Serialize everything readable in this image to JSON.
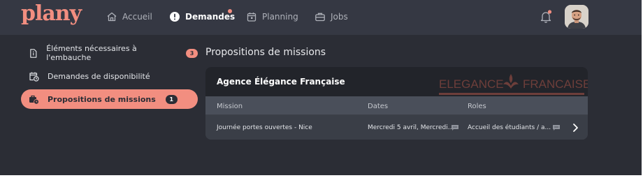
{
  "app": {
    "logo": "plany"
  },
  "nav": {
    "items": [
      {
        "label": "Accueil",
        "icon": "home-icon"
      },
      {
        "label": "Demandes",
        "icon": "alert-circle-icon"
      },
      {
        "label": "Planning",
        "icon": "calendar-icon"
      },
      {
        "label": "Jobs",
        "icon": "briefcase-icon"
      }
    ]
  },
  "sidebar": {
    "items": [
      {
        "label": "Éléments nécessaires à l'embauche",
        "badge": "3",
        "icon": "document-icon"
      },
      {
        "label": "Demandes de disponibilité",
        "icon": "calendar-clock-icon"
      },
      {
        "label": "Propositions de missions",
        "badge": "1",
        "icon": "briefcase-clock-icon"
      }
    ]
  },
  "main": {
    "title": "Propositions de missions",
    "agency": {
      "name": "Agence Élégance Française",
      "logo_text_left": "ELEGANCE",
      "logo_text_right": "FRANCAISE"
    },
    "table": {
      "headers": [
        "Mission",
        "Dates",
        "Roles"
      ],
      "rows": [
        {
          "mission": "Journée portes ouvertes - Nice",
          "dates": "Mercredi 5 avril, Mercredi...",
          "roles": "Accueil des étudiants / a..."
        }
      ]
    }
  },
  "colors": {
    "accent": "#f28e80",
    "background": "#2b2d35",
    "topbar": "#353843"
  }
}
